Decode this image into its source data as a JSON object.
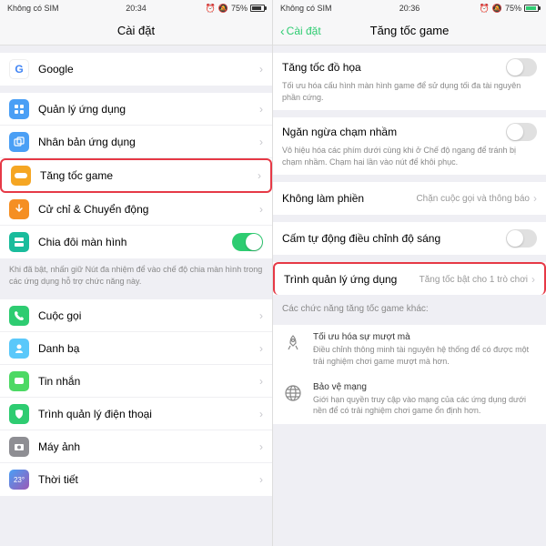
{
  "left": {
    "status": {
      "sim": "Không có SIM",
      "time": "20:34",
      "battery": "75%"
    },
    "title": "Cài đặt",
    "items": {
      "google": "Google",
      "app_mgmt": "Quản lý ứng dụng",
      "app_clone": "Nhân bản ứng dụng",
      "game_boost": "Tăng tốc game",
      "gesture": "Cử chỉ & Chuyển động",
      "split_screen": "Chia đôi màn hình",
      "split_desc": "Khi đã bật, nhấn giữ Nút đa nhiệm để vào chế độ chia màn hình trong các ứng dụng hỗ trợ chức năng này.",
      "calls": "Cuộc gọi",
      "contacts": "Danh bạ",
      "messages": "Tin nhắn",
      "phone_mgr": "Trình quản lý điện thoại",
      "camera": "Máy ảnh",
      "weather": "Thời tiết"
    }
  },
  "right": {
    "status": {
      "sim": "Không có SIM",
      "time": "20:36",
      "battery": "75%"
    },
    "back": "Cài đặt",
    "title": "Tăng tốc game",
    "gfx": {
      "label": "Tăng tốc đồ họa",
      "desc": "Tối ưu hóa cấu hình màn hình game để sử dụng tối đa tài nguyên phần cứng."
    },
    "mistouch": {
      "label": "Ngăn ngừa chạm nhầm",
      "desc": "Vô hiệu hóa các phím dưới cùng khi ở Chế độ ngang để tránh bị chạm nhầm. Chạm hai lần vào nút để khôi phục."
    },
    "dnd": {
      "label": "Không làm phiền",
      "sub": "Chặn cuộc gọi và thông báo"
    },
    "brightness": "Cấm tự động điều chỉnh độ sáng",
    "app_mgr": {
      "label": "Trình quản lý ứng dụng",
      "sub": "Tăng tốc bật cho 1 trò chơi"
    },
    "other_title": "Các chức năng tăng tốc game khác:",
    "feature1": {
      "title": "Tối ưu hóa sự mượt mà",
      "desc": "Điều chỉnh thông minh tài nguyên hệ thống để có được một trải nghiệm chơi game mượt mà hơn."
    },
    "feature2": {
      "title": "Bảo vệ mạng",
      "desc": "Giới hạn quyền truy cập vào mạng của các ứng dụng dưới nền để có trải nghiệm chơi game ổn định hơn."
    }
  }
}
